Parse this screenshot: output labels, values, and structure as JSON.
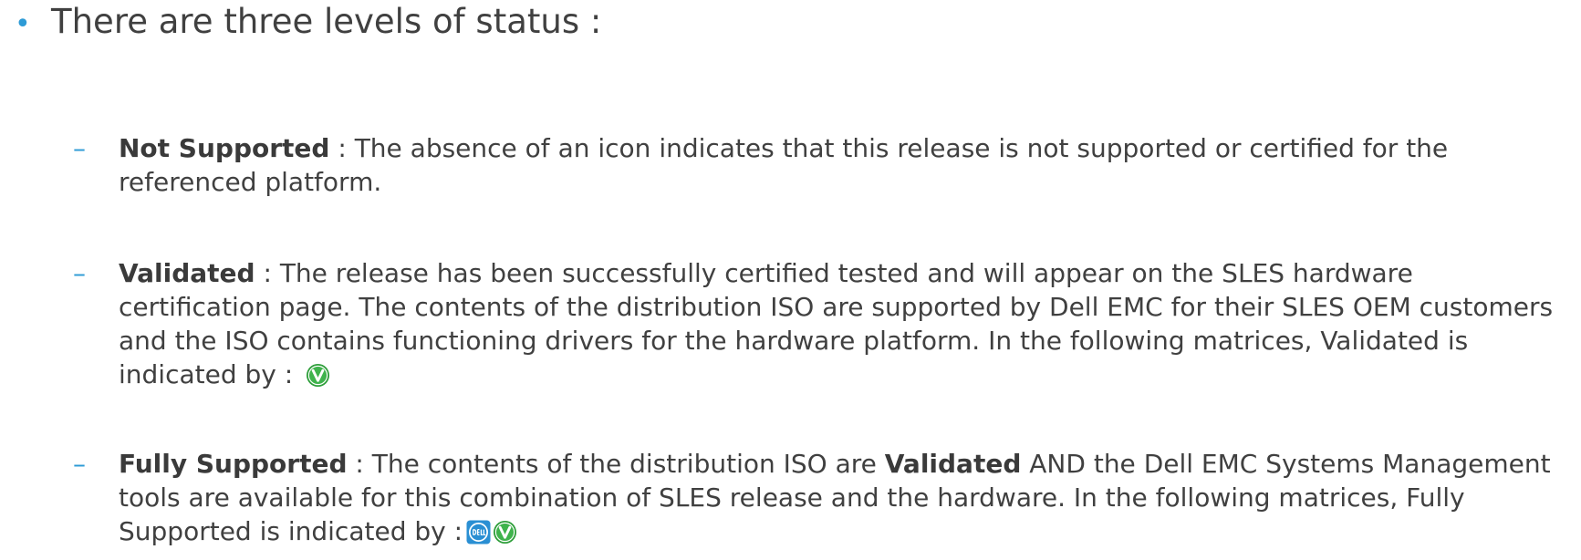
{
  "heading": {
    "bullet": "•",
    "text": "There are three levels of status :"
  },
  "items": [
    {
      "dash": "–",
      "term": "Not Supported",
      "description": " : The absence of an icon indicates that this release is not supported or certified for the referenced platform."
    },
    {
      "dash": "–",
      "term": "Validated",
      "description": " : The release has been successfully certified tested and will appear on the SLES hardware certification page. The contents of the distribution ISO are supported by Dell EMC for their SLES OEM customers and the ISO contains functioning drivers for the hardware platform. In the following matrices, Validated is indicated by :",
      "icons": [
        "validated-icon"
      ]
    },
    {
      "dash": "–",
      "term": "Fully Supported",
      "description_pre": " : The contents of the distribution ISO are ",
      "emphasis": "Validated",
      "description_post": " AND the Dell EMC Systems Management tools are available for this combination of SLES release and the hardware. In the following matrices, Fully Supported is indicated by :",
      "icons": [
        "dell-logo-icon",
        "validated-icon"
      ]
    }
  ],
  "colors": {
    "bullet": "#2e9bd6",
    "text": "#404040",
    "validated_green": "#2e9e3a",
    "dell_blue": "#2a8fd3"
  }
}
